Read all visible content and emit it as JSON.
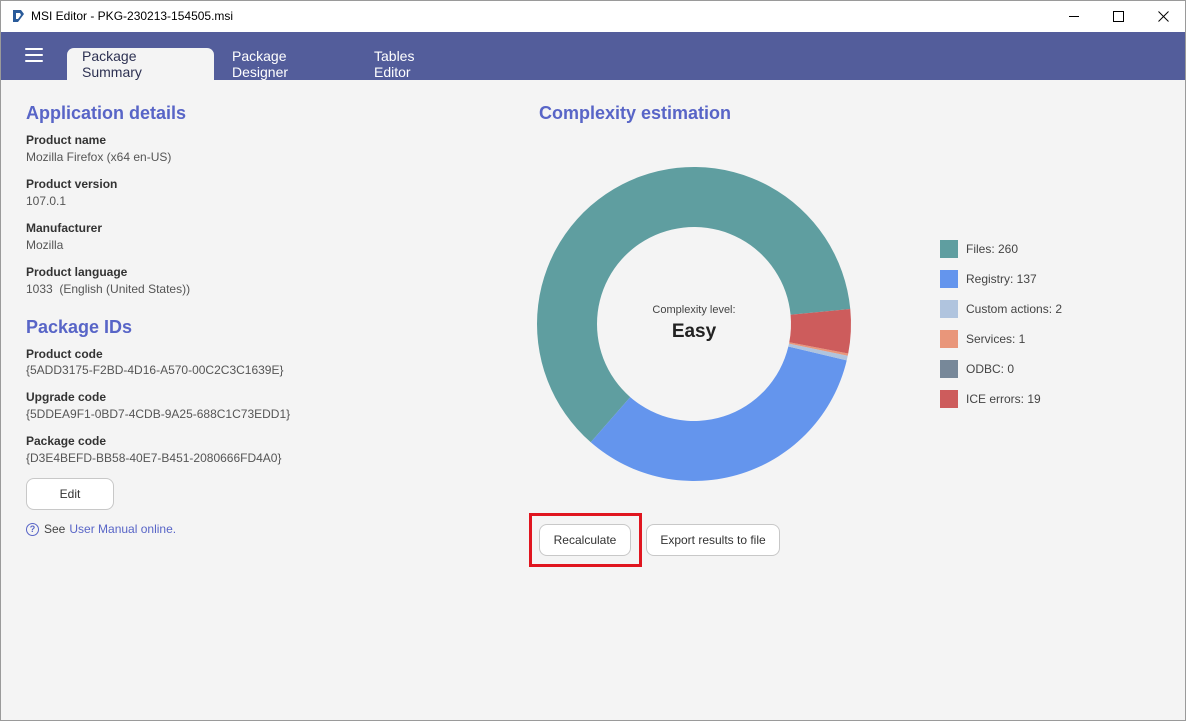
{
  "window": {
    "title": "MSI Editor - PKG-230213-154505.msi",
    "controls": {
      "minimize": "—",
      "maximize": "☐",
      "close": "✕"
    }
  },
  "nav": {
    "tabs": [
      {
        "label": "Package Summary",
        "active": true
      },
      {
        "label": "Package Designer",
        "active": false
      },
      {
        "label": "Tables Editor",
        "active": false
      }
    ]
  },
  "application_details": {
    "heading": "Application details",
    "fields": [
      {
        "label": "Product name",
        "value": "Mozilla Firefox (x64 en-US)"
      },
      {
        "label": "Product version",
        "value": "107.0.1"
      },
      {
        "label": "Manufacturer",
        "value": "Mozilla"
      },
      {
        "label": "Product language",
        "value": "1033  (English (United States))"
      }
    ]
  },
  "package_ids": {
    "heading": "Package IDs",
    "fields": [
      {
        "label": "Product code",
        "value": "{5ADD3175-F2BD-4D16-A570-00C2C3C1639E}"
      },
      {
        "label": "Upgrade code",
        "value": "{5DDEA9F1-0BD7-4CDB-9A25-688C1C73EDD1}"
      },
      {
        "label": "Package code",
        "value": "{D3E4BEFD-BB58-40E7-B451-2080666FD4A0}"
      }
    ],
    "edit_label": "Edit"
  },
  "help": {
    "prefix": "See",
    "link_text": "User Manual online."
  },
  "complexity": {
    "heading": "Complexity estimation",
    "center_label": "Complexity level:",
    "center_value": "Easy",
    "recalculate_label": "Recalculate",
    "export_label": "Export results to file"
  },
  "chart_data": {
    "type": "pie",
    "variant": "donut",
    "categories": [
      "Files",
      "Registry",
      "Custom actions",
      "Services",
      "ODBC",
      "ICE errors"
    ],
    "values": [
      260,
      137,
      2,
      1,
      0,
      19
    ],
    "legend": [
      "Files: 260",
      "Registry: 137",
      "Custom actions: 2",
      "Services: 1",
      "ODBC: 0",
      "ICE errors: 19"
    ],
    "colors": [
      "#5f9ea0",
      "#6495ed",
      "#b0c4de",
      "#e9967a",
      "#778899",
      "#cd5c5c"
    ],
    "legend_position": "right"
  },
  "colors": {
    "nav_background": "#535d9b",
    "accent": "#5865c7",
    "highlight": "#e0151f"
  }
}
